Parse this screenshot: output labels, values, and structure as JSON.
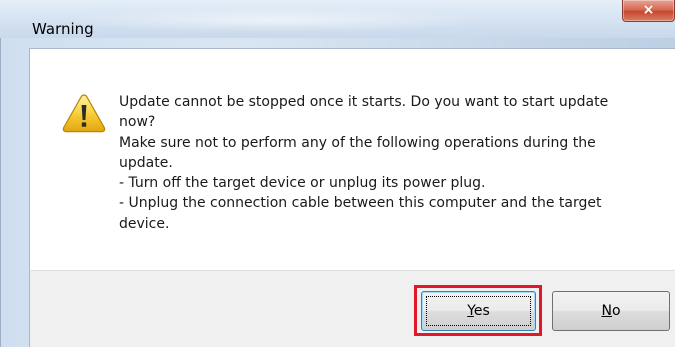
{
  "window": {
    "title": "Warning",
    "close_glyph": "×",
    "icon": "close-icon"
  },
  "dialog": {
    "icon": "warning-triangle-icon",
    "message": "Update cannot be stopped once it starts. Do you want to start update\nnow?\nMake sure not to perform any of the following operations during the\nupdate.\n- Turn off the target device or unplug its power plug.\n- Unplug the connection cable between this computer and the target\ndevice."
  },
  "buttons": {
    "yes": {
      "mnemonic": "Y",
      "rest": "es",
      "focused": true,
      "highlighted": true
    },
    "no": {
      "mnemonic": "N",
      "rest": "o"
    }
  },
  "colors": {
    "highlight_border": "#e0182a",
    "close_button": "#c7472f",
    "warning_yellow": "#f5c518"
  }
}
